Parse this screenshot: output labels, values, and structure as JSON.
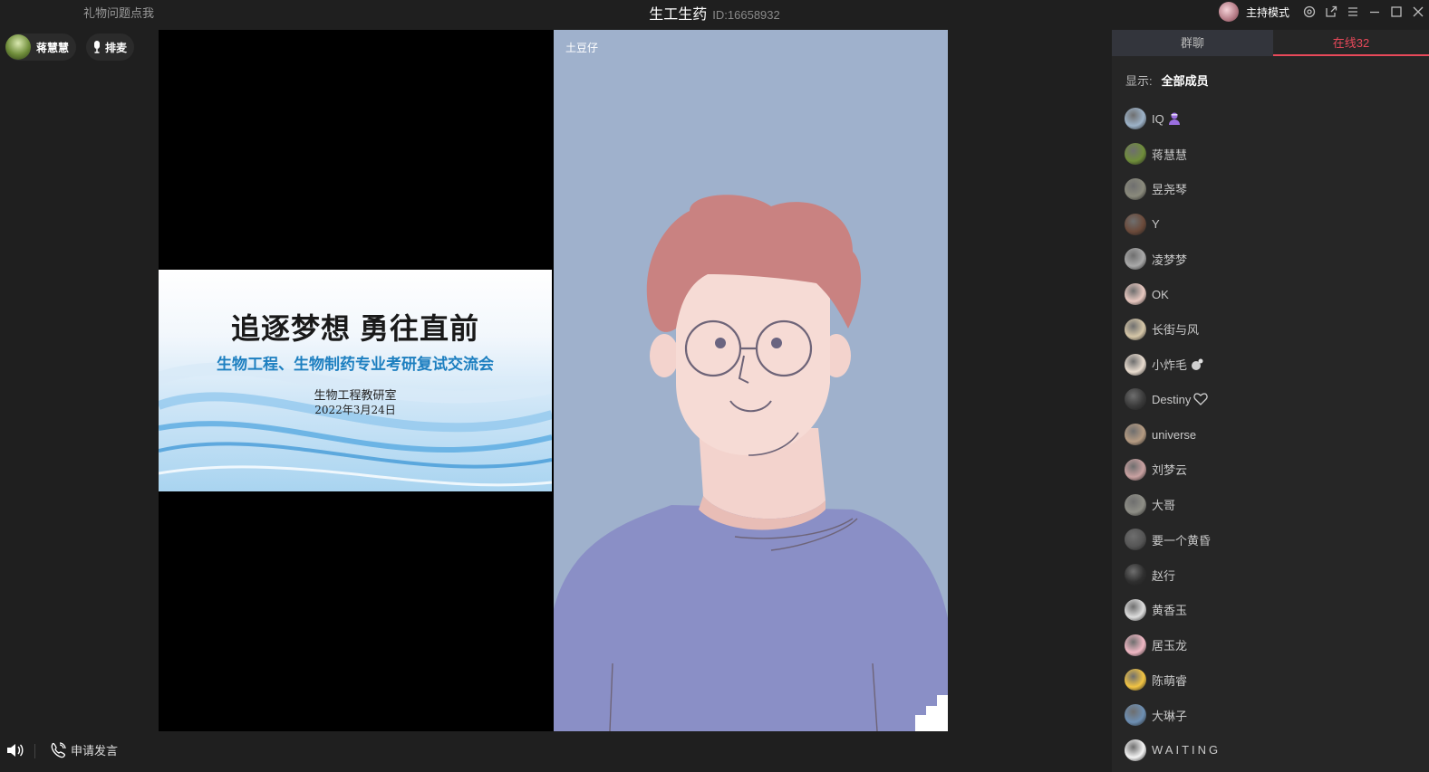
{
  "topbar": {
    "gift_link": "礼物问题点我",
    "room_name": "生工生药",
    "room_id": "ID:16658932",
    "host_mode": "主持模式"
  },
  "stage_header": {
    "speaker_name": "蒋慧慧",
    "queue_label": "排麦"
  },
  "slide": {
    "title": "追逐梦想 勇往直前",
    "subtitle": "生物工程、生物制药专业考研复试交流会",
    "department": "生物工程教研室",
    "date": "2022年3月24日"
  },
  "right_video": {
    "name": "土豆仔"
  },
  "bottombar": {
    "apply_label": "申请发言"
  },
  "panel": {
    "tabs": [
      {
        "label": "群聊",
        "active": false
      },
      {
        "label": "在线32",
        "active": true
      }
    ],
    "filter_label": "显示:",
    "filter_value": "全部成员",
    "accent_color": "#e8495a",
    "members": [
      {
        "name": "IQ",
        "badge": "purple-person-icon",
        "avatar": "#9db3c9"
      },
      {
        "name": "蒋慧慧",
        "avatar": "#6f8d3a"
      },
      {
        "name": "昱尧琴",
        "avatar": "#8a8a7c"
      },
      {
        "name": "Y",
        "avatar": "#6b4a3a"
      },
      {
        "name": "凌梦梦",
        "avatar": "#a9a9a9"
      },
      {
        "name": "OK",
        "avatar": "#e8c8c0"
      },
      {
        "name": "长街与风",
        "avatar": "#d6c7a8"
      },
      {
        "name": "小炸毛",
        "badge": "flower-icon",
        "avatar": "#e9dccf"
      },
      {
        "name": "Destiny",
        "badge": "heart-icon",
        "avatar": "#3a3a3a"
      },
      {
        "name": "universe",
        "avatar": "#b59b82"
      },
      {
        "name": "刘梦云",
        "avatar": "#c9a1a1"
      },
      {
        "name": "大哥",
        "avatar": "#8e8e86"
      },
      {
        "name": "要一个黄昏",
        "avatar": "#555555"
      },
      {
        "name": "赵行",
        "avatar": "#2f2f2f"
      },
      {
        "name": "黄香玉",
        "avatar": "#dedede"
      },
      {
        "name": "居玉龙",
        "avatar": "#f0b8c4"
      },
      {
        "name": "陈萌睿",
        "avatar": "#f2c443"
      },
      {
        "name": "大琳子",
        "avatar": "#6d8fb3"
      },
      {
        "name": "WAITING",
        "avatar": "#f4f4f4"
      }
    ]
  }
}
